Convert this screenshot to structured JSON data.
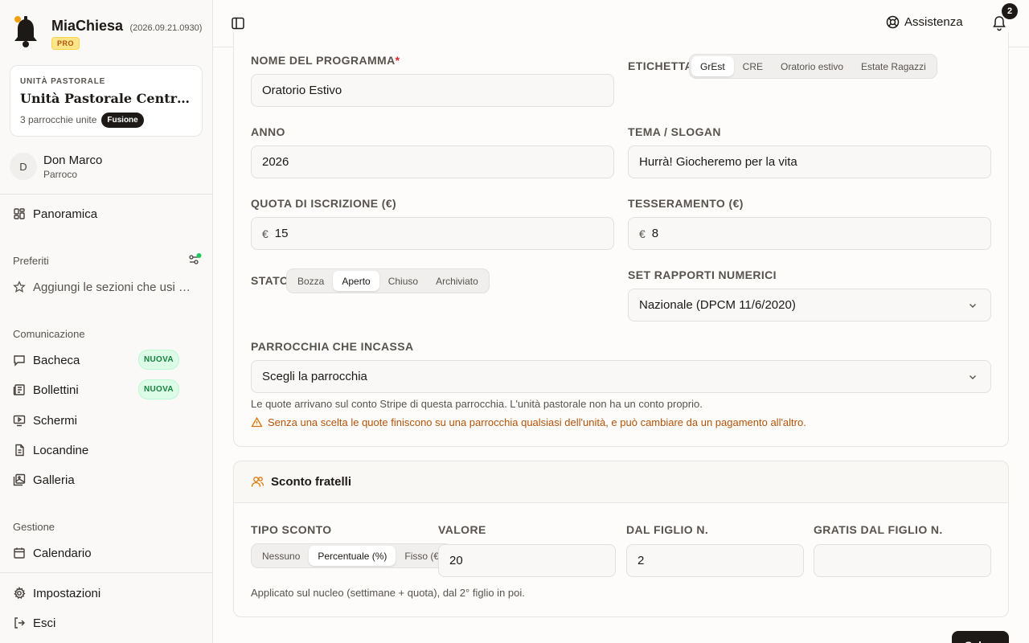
{
  "app": {
    "name": "MiaChiesa",
    "version": "(2026.09.21.0930)",
    "plan": "PRO"
  },
  "unit": {
    "label": "UNITÀ PASTORALE",
    "name": "Unità Pastorale Centro Storico",
    "parishes": "3 parrocchie unite",
    "badge": "Fusione"
  },
  "user": {
    "initial": "D",
    "name": "Don Marco",
    "role": "Parroco"
  },
  "nav": {
    "overview": "Panoramica",
    "favorites_title": "Preferiti",
    "favorites_hint": "Aggiungi le sezioni che usi di più",
    "communication_title": "Comunicazione",
    "bacheca": "Bacheca",
    "bollettini": "Bollettini",
    "schermi": "Schermi",
    "locandine": "Locandine",
    "galleria": "Galleria",
    "new_badge": "NUOVA",
    "management_title": "Gestione",
    "calendario": "Calendario",
    "impostazioni": "Impostazioni",
    "esci": "Esci"
  },
  "topbar": {
    "assist": "Assistenza",
    "notifications": "2"
  },
  "form": {
    "program_name_label": "NOME DEL PROGRAMMA",
    "program_name_value": "Oratorio Estivo",
    "tag_label": "ETICHETTA",
    "tags": [
      "GrEst",
      "CRE",
      "Oratorio estivo",
      "Estate Ragazzi"
    ],
    "year_label": "ANNO",
    "year_value": "2026",
    "theme_label": "TEMA / SLOGAN",
    "theme_value": "Hurrà! Giocheremo per la vita",
    "fee_label": "QUOTA DI ISCRIZIONE (€)",
    "fee_value": "15",
    "membership_label": "TESSERAMENTO (€)",
    "membership_value": "8",
    "currency": "€",
    "state_label": "STATO",
    "states": [
      "Bozza",
      "Aperto",
      "Chiuso",
      "Archiviato"
    ],
    "ratio_label": "SET RAPPORTI NUMERICI",
    "ratio_value": "Nazionale (DPCM 11/6/2020)",
    "parish_label": "PARROCCHIA CHE INCASSA",
    "parish_value": "Scegli la parrocchia",
    "parish_help": "Le quote arrivano sul conto Stripe di questa parrocchia. L'unità pastorale non ha un conto proprio.",
    "parish_warning": "Senza una scelta le quote finiscono su una parrocchia qualsiasi dell'unità, e può cambiare da un pagamento all'altro."
  },
  "discount": {
    "title": "Sconto fratelli",
    "type_label": "TIPO SCONTO",
    "types": [
      "Nessuno",
      "Percentuale (%)",
      "Fisso (€)"
    ],
    "value_label": "VALORE",
    "value": "20",
    "from_child_label": "DAL FIGLIO N.",
    "from_child_value": "2",
    "free_from_label": "GRATIS DAL FIGLIO N.",
    "free_from_value": "",
    "help": "Applicato sul nucleo (settimane + quota), dal 2° figlio in poi."
  },
  "actions": {
    "save": "Salva"
  },
  "colors": {
    "accent": "#1c1917",
    "brand_bell": "#1c1917",
    "warning": "#b45309",
    "new_badge": "#15803d",
    "required": "#dc2626"
  }
}
